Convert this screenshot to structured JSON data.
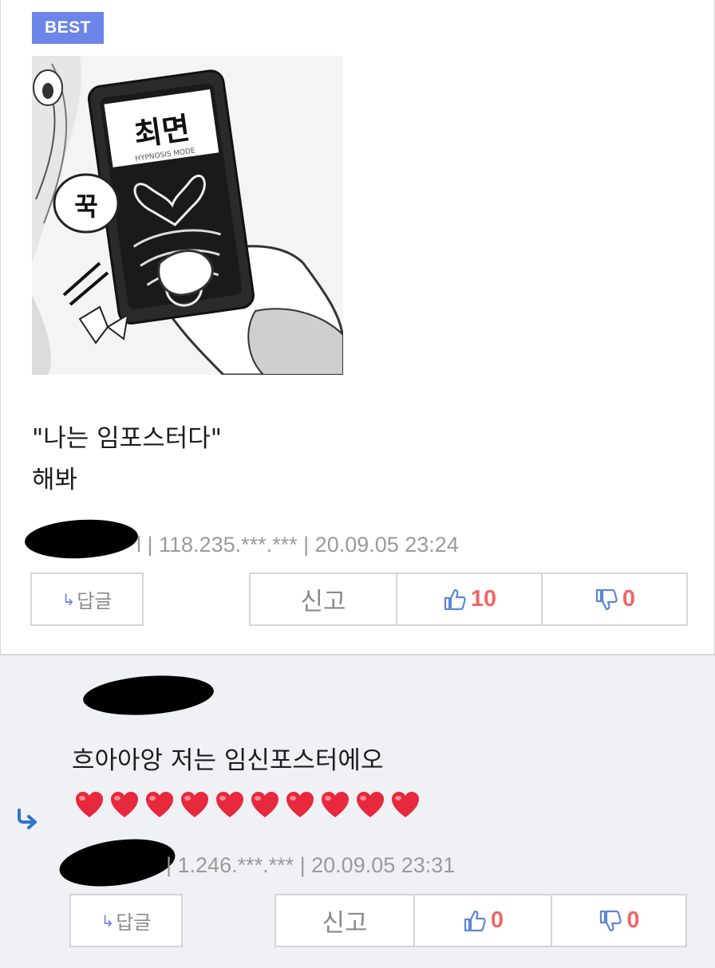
{
  "best_comment": {
    "badge": "BEST",
    "image_caption": "최면",
    "image_sub": "HYPNOSIS MODE",
    "image_bubble": "꾹",
    "lines": [
      "\"나는 임포스터다\"",
      "해봐"
    ],
    "meta": "l | 118.235.***.*** | 20.09.05 23:24",
    "buttons": {
      "reply": "답글",
      "reply_arrow": "↳",
      "report": "신고",
      "like_count": "10",
      "dislike_count": "0"
    }
  },
  "reply_comment": {
    "lines": [
      "흐아아앙 저는 임신포스터에오"
    ],
    "heart_count": 10,
    "meta": "| 1.246.***.*** | 20.09.05 23:31",
    "buttons": {
      "reply": "답글",
      "reply_arrow": "↳",
      "report": "신고",
      "like_count": "0",
      "dislike_count": "0"
    }
  },
  "colors": {
    "accent": "#6c85e8",
    "count_red": "#f06666",
    "reply_bg": "#eff1f4",
    "heart": "#e8283c"
  },
  "icons": [
    "thumbs-up-icon",
    "thumbs-down-icon",
    "reply-arrow-icon",
    "heart-icon"
  ]
}
